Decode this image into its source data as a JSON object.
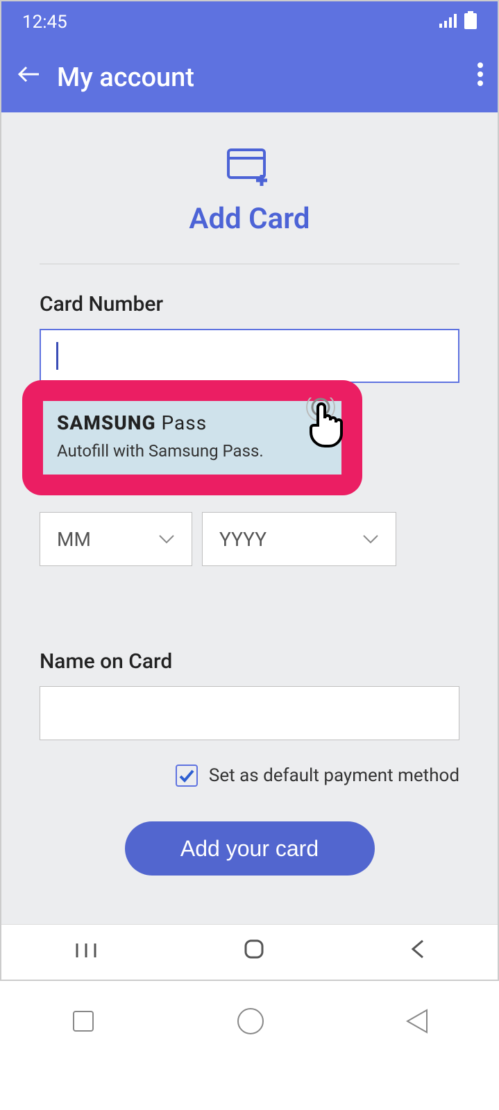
{
  "status": {
    "time": "12:45"
  },
  "appbar": {
    "title": "My account"
  },
  "header": {
    "title": "Add Card"
  },
  "form": {
    "card_number_label": "Card Number",
    "card_number_value": "",
    "samsung_pass_brand": "SAMSUNG",
    "samsung_pass_word": "Pass",
    "samsung_pass_sub": "Autofill with Samsung Pass.",
    "month_placeholder": "MM",
    "year_placeholder": "YYYY",
    "name_label": "Name on Card",
    "name_value": "",
    "default_label": "Set as default payment method",
    "default_checked": true,
    "submit_label": "Add your card"
  }
}
